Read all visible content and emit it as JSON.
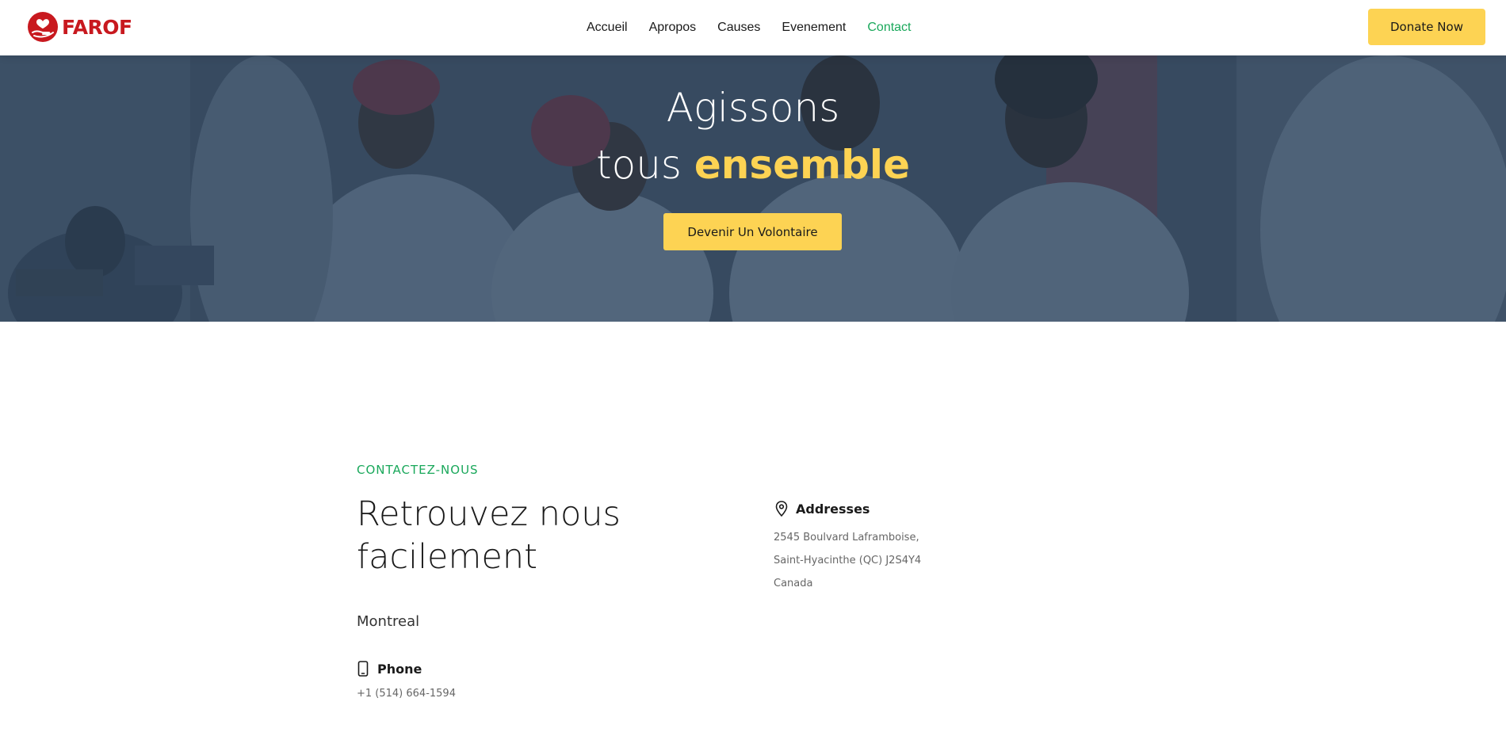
{
  "header": {
    "logo_text": "FAROF",
    "nav": [
      "Accueil",
      "Apropos",
      "Causes",
      "Evenement",
      "Contact"
    ],
    "active_nav": "Contact",
    "donate_label": "Donate Now"
  },
  "hero": {
    "title_line1": "Agissons",
    "title_line2_plain": "tous",
    "title_line2_highlight": "ensemble",
    "cta_label": "Devenir Un Volontaire"
  },
  "contact": {
    "eyebrow": "CONTACTEZ-NOUS",
    "title": "Retrouvez nous facilement",
    "city": "Montreal",
    "phone": {
      "label": "Phone",
      "icon": "smartphone-icon",
      "value": "+1 (514) 664-1594"
    },
    "address": {
      "label": "Addresses",
      "icon": "map-pin-icon",
      "lines": [
        "2545 Boulvard Laframboise,",
        "Saint-Hyacinthe (QC) J2S4Y4",
        "Canada"
      ]
    }
  },
  "colors": {
    "brand_red": "#c8191f",
    "accent_yellow": "#fdd353",
    "active_green": "#1aa85b",
    "hero_overlay": "#2c3e54"
  }
}
